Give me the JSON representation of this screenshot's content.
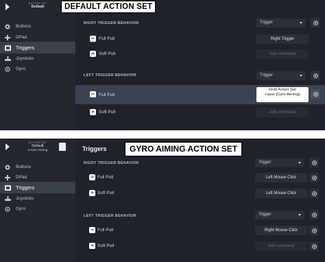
{
  "panel1": {
    "banner": "DEFAULT ACTION SET",
    "sidebar": {
      "label": "ACTION SET",
      "name": "Default",
      "items": [
        {
          "label": "Buttons",
          "icon": "buttons-icon",
          "active": false
        },
        {
          "label": "DPad",
          "icon": "dpad-icon",
          "active": false
        },
        {
          "label": "Triggers",
          "icon": "triggers-icon",
          "active": true
        },
        {
          "label": "Joysticks",
          "icon": "joystick-icon",
          "active": false
        },
        {
          "label": "Gyro",
          "icon": "gyro-icon",
          "active": false
        }
      ]
    },
    "right": {
      "title": "RIGHT TRIGGER BEHAVIOR",
      "dropdown": "Trigger",
      "full_pull": {
        "label": "Full Pull",
        "icon_text": "2A",
        "command": "Right Trigger"
      },
      "soft_pull": {
        "label": "Soft Pull",
        "icon_text": "2B",
        "command": "Add command"
      }
    },
    "left": {
      "title": "LEFT TRIGGER BEHAVIOR",
      "dropdown": "Trigger",
      "full_pull": {
        "label": "Full Pull",
        "icon_text": "1A",
        "command_line1": "Hold Action Set",
        "command_line2": "Layer (Gyro Aiming)"
      },
      "soft_pull": {
        "label": "Soft Pull",
        "icon_text": "1B",
        "command": "Add command"
      }
    }
  },
  "panel2": {
    "banner": "GYRO AIMING ACTION SET",
    "page_title": "Triggers",
    "sidebar": {
      "label": "ACTION SET",
      "name": "Default",
      "sub": "Gyro Aiming",
      "items": [
        {
          "label": "Buttons",
          "icon": "buttons-icon",
          "active": false
        },
        {
          "label": "DPad",
          "icon": "dpad-icon",
          "active": false
        },
        {
          "label": "Triggers",
          "icon": "triggers-icon",
          "active": true
        },
        {
          "label": "Joysticks",
          "icon": "joystick-icon",
          "active": false
        },
        {
          "label": "Gyro",
          "icon": "gyro-icon",
          "active": false
        }
      ]
    },
    "right": {
      "title": "RIGHT TRIGGER BEHAVIOR",
      "dropdown": "Trigger",
      "full_pull": {
        "label": "Full Pull",
        "icon_text": "2A",
        "command": "Left Mouse Click"
      },
      "soft_pull": {
        "label": "Soft Pull",
        "icon_text": "2B",
        "command": "Left Mouse Click"
      }
    },
    "left": {
      "title": "LEFT TRIGGER BEHAVIOR",
      "dropdown": "Trigger",
      "full_pull": {
        "label": "Full Pull",
        "icon_text": "1A",
        "command": "Right Mouse Click"
      },
      "soft_pull": {
        "label": "Soft Pull",
        "icon_text": "1B",
        "command": "Add command"
      }
    }
  }
}
